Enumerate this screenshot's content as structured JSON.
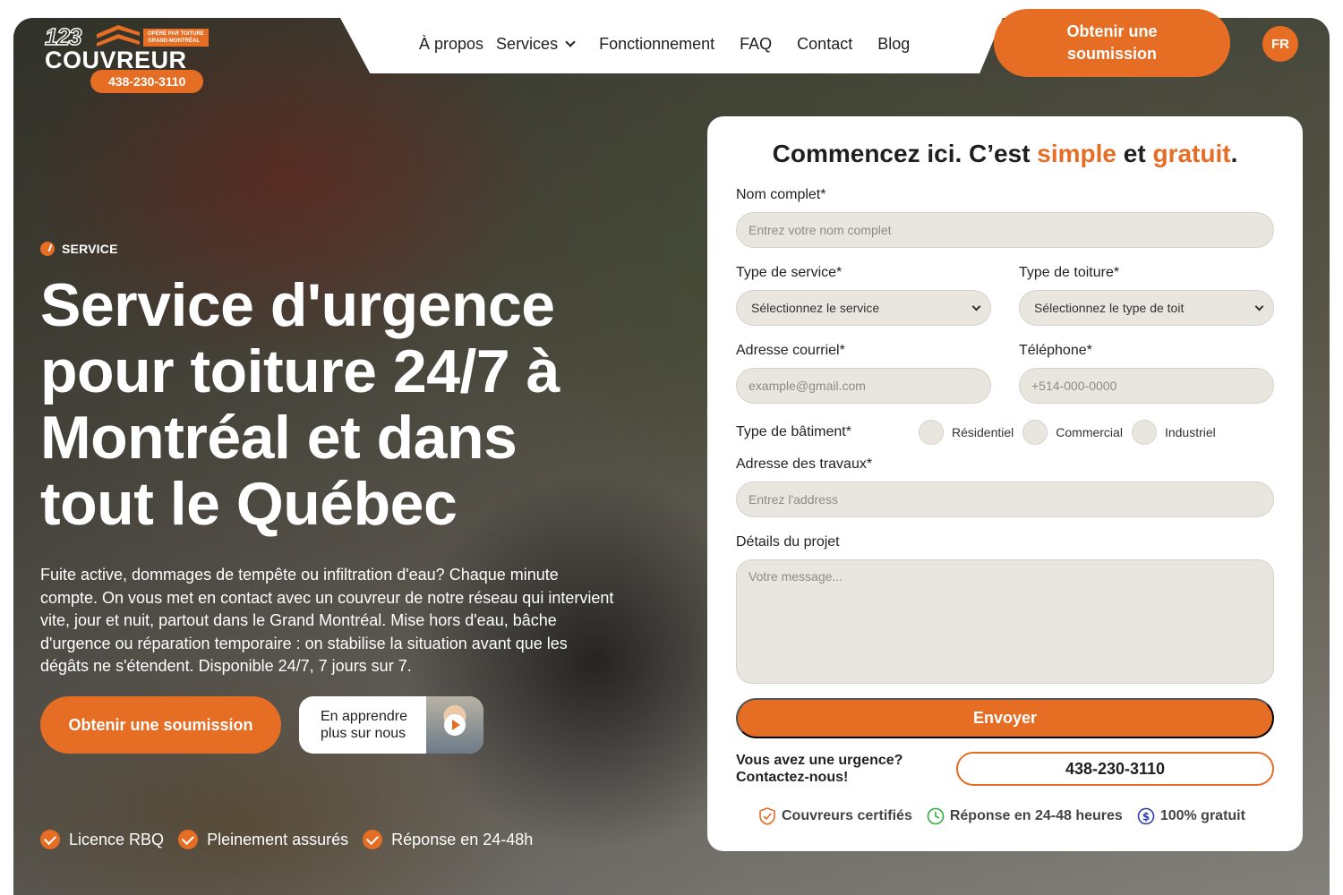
{
  "brand": {
    "logo_number": "123",
    "logo_name": "COUVREUR",
    "logo_tag_line1": "OPÉRÉ PAR TOITURE",
    "logo_tag_line2": "GRAND-MONTRÉAL",
    "phone": "438-230-3110",
    "accent_color": "#e56d24"
  },
  "nav": {
    "items": [
      {
        "label": "À propos"
      },
      {
        "label": "Services"
      },
      {
        "label": "Fonctionnement"
      },
      {
        "label": "FAQ"
      },
      {
        "label": "Contact"
      },
      {
        "label": "Blog"
      }
    ],
    "cta_label": "Obtenir une soumission",
    "language": "FR"
  },
  "hero": {
    "badge": "SERVICE",
    "title": "Service d'urgence pour toiture 24/7 à Montréal et dans tout le Québec",
    "description": "Fuite active, dommages de tempête ou infiltration d'eau? Chaque minute compte. On vous met en contact avec un couvreur de notre réseau qui intervient vite, jour et nuit, partout dans le Grand Montréal. Mise hors d'eau, bâche d'urgence ou réparation temporaire : on stabilise la situation avant que les dégâts ne s'étendent. Disponible 24/7, 7 jours sur 7.",
    "quote_button": "Obtenir une soumission",
    "video_button": "En apprendre plus sur nous",
    "features": [
      "Licence RBQ",
      "Pleinement assurés",
      "Réponse en 24-48h"
    ]
  },
  "form": {
    "title_part1": "Commencez ici. C’est ",
    "title_accent1": "simple",
    "title_part2": " et ",
    "title_accent2": "gratuit",
    "title_part3": ".",
    "name_label": "Nom complet*",
    "name_placeholder": "Entrez votre nom complet",
    "service_label": "Type de service*",
    "service_value": "Sélectionnez le service",
    "roof_label": "Type de toiture*",
    "roof_value": "Sélectionnez le type de toit",
    "email_label": "Adresse courriel*",
    "email_placeholder": "example@gmail.com",
    "phone_label": "Téléphone*",
    "phone_placeholder": "+514-000-0000",
    "building_label": "Type de bâtiment*",
    "building_options": [
      "Résidentiel",
      "Commercial",
      "Industriel"
    ],
    "address_label": "Adresse des travaux*",
    "address_placeholder": "Entrez l'address",
    "details_label": "Détails du projet",
    "details_placeholder": "Votre message...",
    "submit_label": "Envoyer",
    "urgent_text": "Vous avez une urgence? Contactez-nous!",
    "urgent_phone": "438-230-3110",
    "trust": [
      {
        "label": "Couvreurs certifiés",
        "icon": "shield-check-icon",
        "color": "#e56d24"
      },
      {
        "label": "Réponse en 24-48 heures",
        "icon": "clock-icon",
        "color": "#2fae3f"
      },
      {
        "label": "100% gratuit",
        "icon": "dollar-icon",
        "color": "#2b3fb0"
      }
    ]
  }
}
